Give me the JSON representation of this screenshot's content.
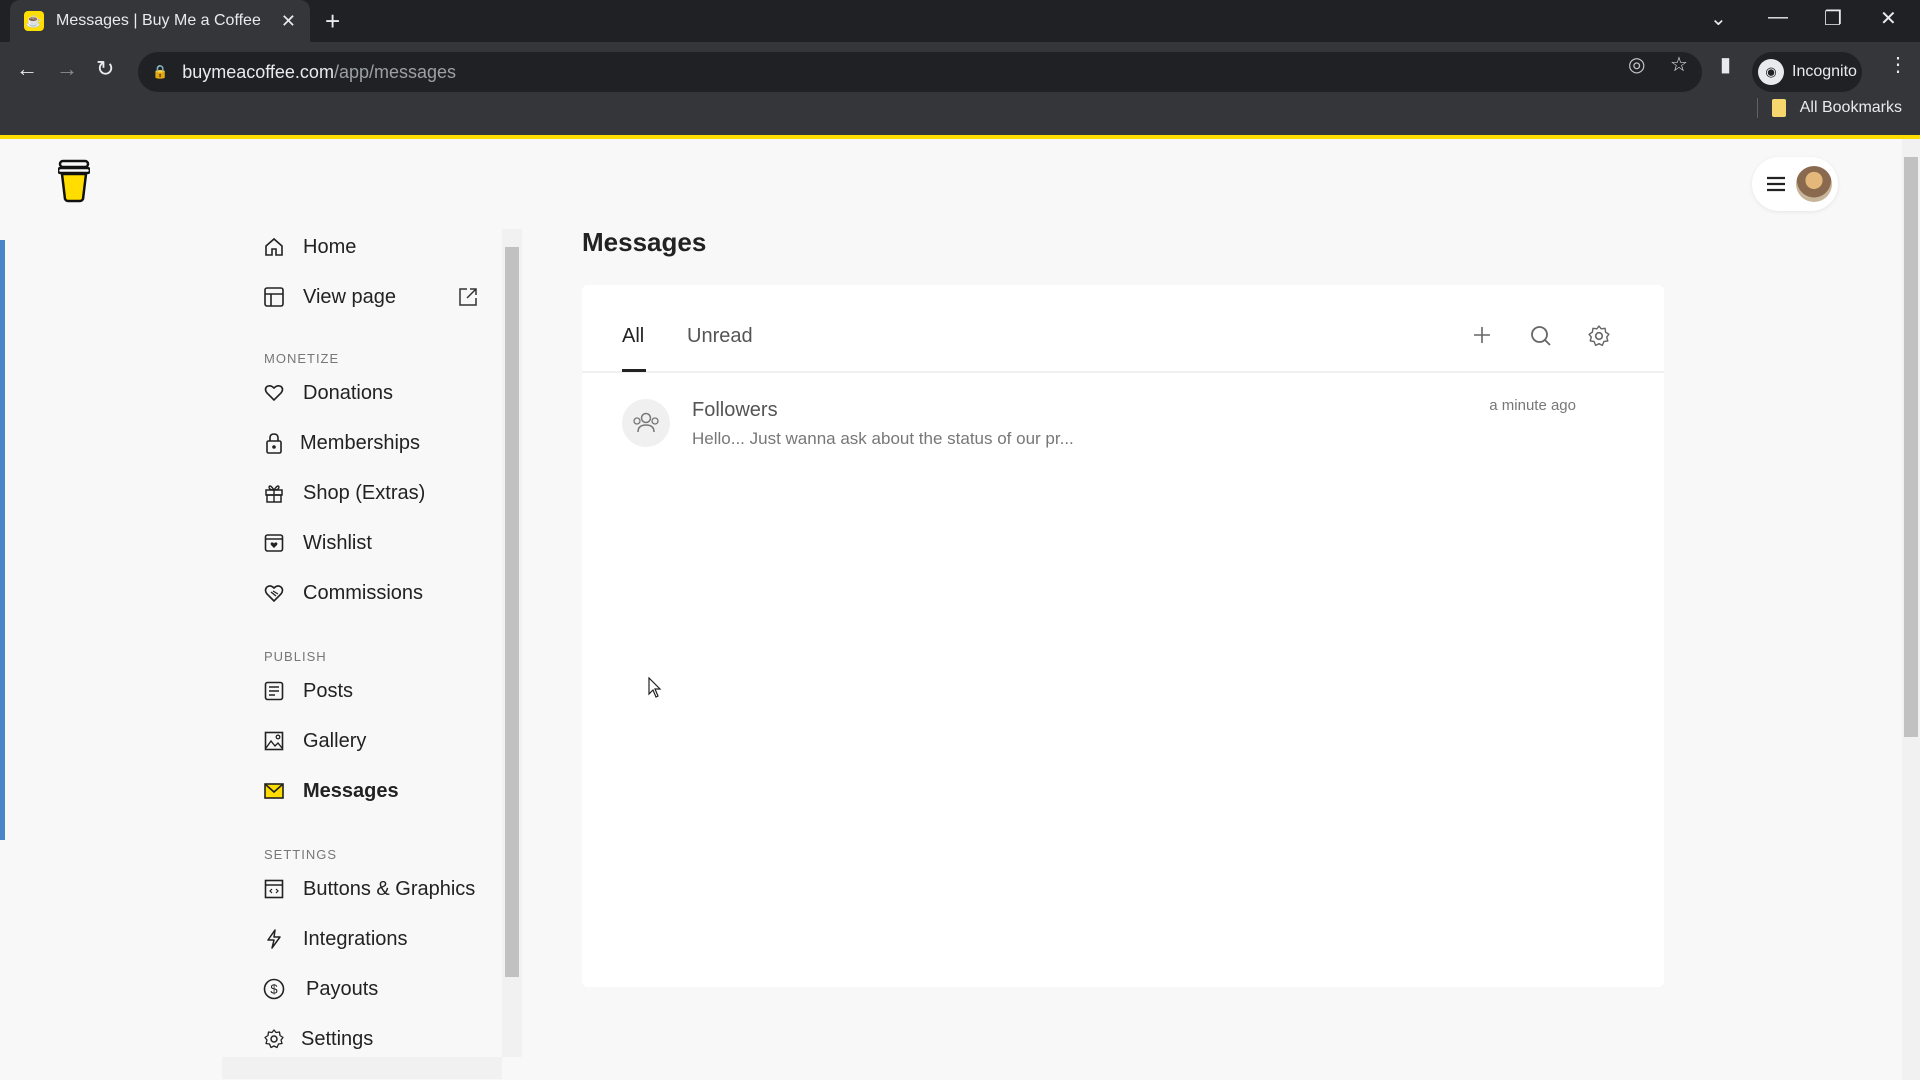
{
  "browser": {
    "tab_title": "Messages | Buy Me a Coffee",
    "url_host": "buymeacoffee.com",
    "url_path": "/app/messages",
    "profile_label": "Incognito",
    "bookmarks_label": "All Bookmarks"
  },
  "sidebar": {
    "home": "Home",
    "view_page": "View page",
    "monetize_header": "MONETIZE",
    "donations": "Donations",
    "memberships": "Memberships",
    "shop": "Shop (Extras)",
    "wishlist": "Wishlist",
    "commissions": "Commissions",
    "publish_header": "PUBLISH",
    "posts": "Posts",
    "gallery": "Gallery",
    "messages": "Messages",
    "settings_header": "SETTINGS",
    "buttons_graphics": "Buttons & Graphics",
    "integrations": "Integrations",
    "payouts": "Payouts",
    "settings": "Settings",
    "active_item": "Messages",
    "accent_color": "#ffdd00"
  },
  "main": {
    "title": "Messages",
    "tabs": [
      {
        "label": "All",
        "active": true
      },
      {
        "label": "Unread",
        "active": false
      }
    ],
    "messages": [
      {
        "sender": "Followers",
        "preview": "Hello... Just wanna ask about the status of our pr...",
        "time": "a minute ago"
      }
    ]
  }
}
